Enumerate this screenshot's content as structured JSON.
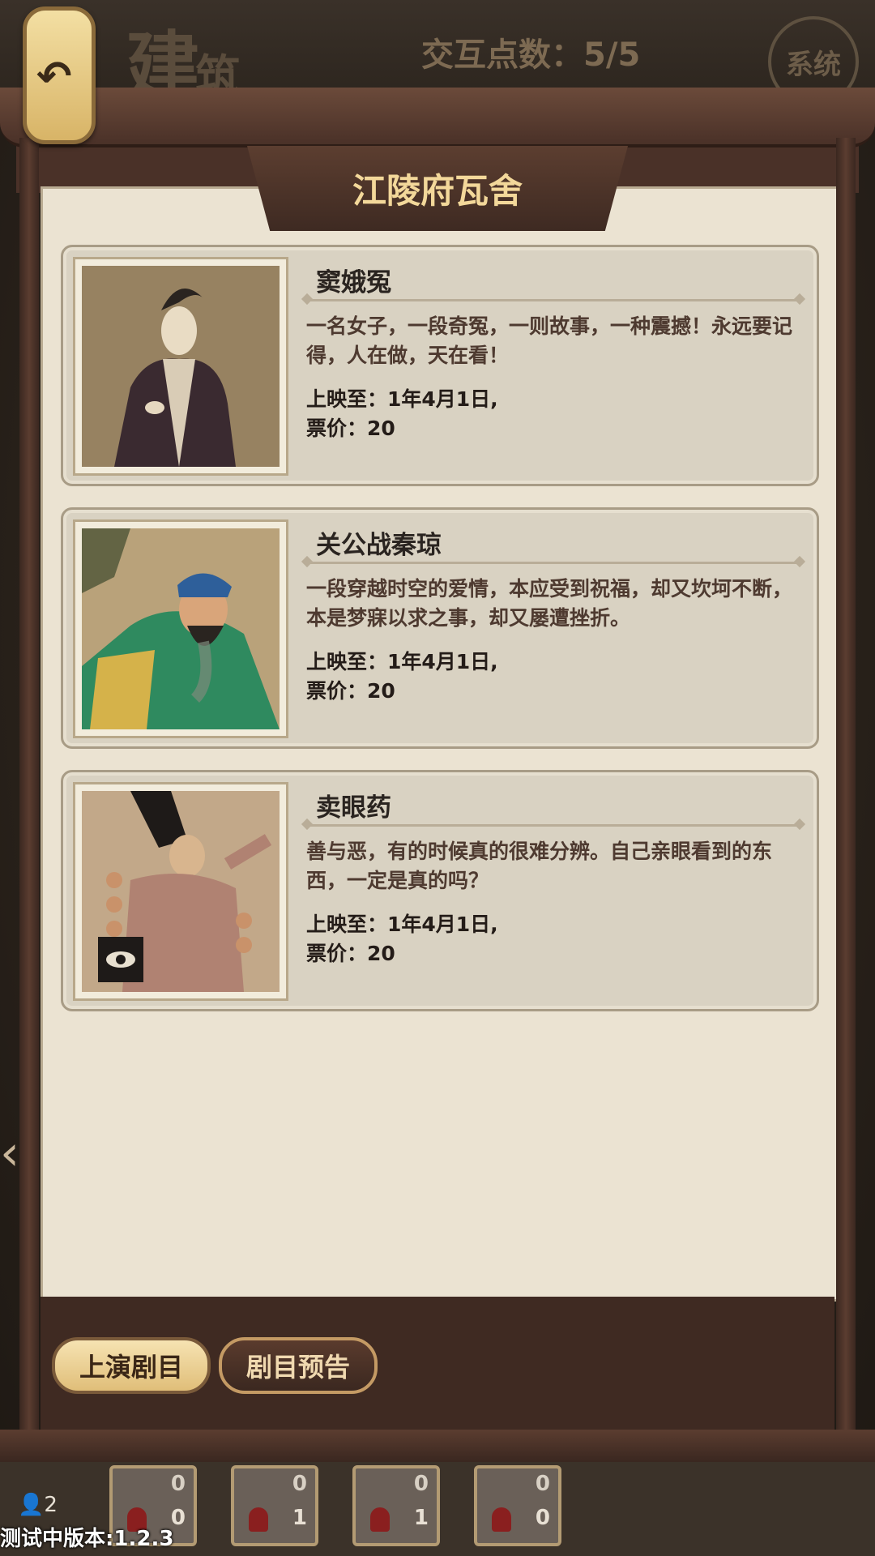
{
  "header": {
    "title_big": "建",
    "title_small": "筑",
    "points_label": "交互点数：5/5",
    "system_button": "系统"
  },
  "panel": {
    "title": "江陵府瓦舍"
  },
  "cards": [
    {
      "title": "窦娥冤",
      "desc": "一名女子，一段奇冤，一则故事，一种震撼！永远要记得，人在做，天在看！",
      "date": "上映至：1年4月1日,",
      "price": "票价：20"
    },
    {
      "title": "关公战秦琼",
      "desc": "一段穿越时空的爱情，本应受到祝福，却又坎坷不断，本是梦寐以求之事，却又屡遭挫折。",
      "date": "上映至：1年4月1日,",
      "price": "票价：20"
    },
    {
      "title": "卖眼药",
      "desc": "善与恶，有的时候真的很难分辨。自己亲眼看到的东西，一定是真的吗？",
      "date": "上映至：1年4月1日,",
      "price": "票价：20"
    }
  ],
  "tabs": {
    "active": "上演剧目",
    "inactive": "剧目预告"
  },
  "hud": {
    "count": "2",
    "slots": [
      {
        "top": "0",
        "bottom": "0"
      },
      {
        "top": "0",
        "bottom": "1"
      },
      {
        "top": "0",
        "bottom": "1"
      },
      {
        "top": "0",
        "bottom": "0"
      }
    ]
  },
  "version": "测试中版本:1.2.3"
}
